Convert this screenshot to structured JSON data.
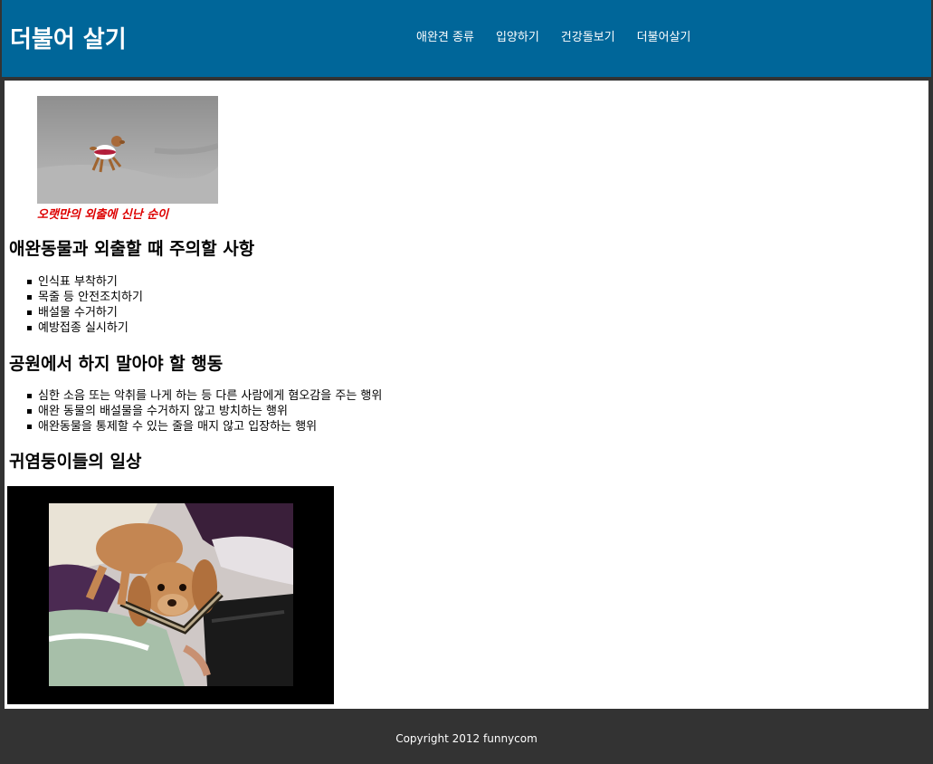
{
  "header": {
    "title": "더불어 살기",
    "nav": [
      "애완견 종류",
      "입양하기",
      "건강돌보기",
      "더불어살기"
    ]
  },
  "main": {
    "photo_caption": "오랫만의 외출에 신난 순이",
    "section1": {
      "heading": "애완동물과 외출할 때 주의할 사항",
      "items": [
        "인식표 부착하기",
        "목줄 등 안전조치하기",
        "배설물 수거하기",
        "예방접종 실시하기"
      ]
    },
    "section2": {
      "heading": "공원에서 하지 말아야 할 행동",
      "items": [
        "심한 소음 또는 악취를 나게 하는 등 다른 사람에게 혐오감을 주는 행위",
        "애완 동물의 배설물을 수거하지 않고 방치하는 행위",
        "애완동물을 통제할 수 있는 줄을 매지 않고 입장하는 행위"
      ]
    },
    "section3": {
      "heading": "귀염둥이들의 일상"
    }
  },
  "footer": {
    "copyright": "Copyright 2012 funnycom"
  },
  "colors": {
    "header_bg": "#006699",
    "page_bg": "#333333",
    "caption": "#dd0000"
  }
}
